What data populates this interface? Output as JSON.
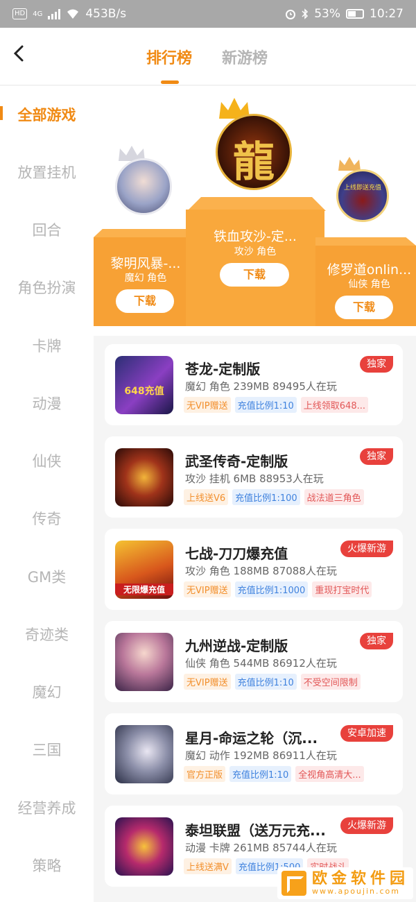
{
  "statusbar": {
    "hd": "HD",
    "net": "4G",
    "speed": "453B/s",
    "battery": "53%",
    "time": "10:27"
  },
  "header": {
    "tabs": [
      {
        "label": "排行榜",
        "active": true
      },
      {
        "label": "新游榜",
        "active": false
      }
    ]
  },
  "sidebar": {
    "categories": [
      "全部游戏",
      "放置挂机",
      "回合",
      "角色扮演",
      "卡牌",
      "动漫",
      "仙侠",
      "传奇",
      "GM类",
      "奇迹类",
      "魔幻",
      "三国",
      "经营养成",
      "策略"
    ]
  },
  "podium": {
    "first": {
      "name": "铁血攻沙-定...",
      "tags": "攻沙 角色",
      "button": "下载",
      "avatar_text": "龍"
    },
    "second": {
      "name": "黎明风暴-...",
      "tags": "魔幻 角色",
      "button": "下载"
    },
    "third": {
      "name": "修罗道onlin...",
      "tags": "仙侠 角色",
      "button": "下载",
      "avatar_text": "上线即送充值"
    }
  },
  "games": [
    {
      "name": "苍龙-定制版",
      "meta": "魔幻 角色 239MB 89495人在玩",
      "badge": "独家",
      "thumb_text": "648充值",
      "tags": [
        {
          "text": "无VIP赠送",
          "kind": "or"
        },
        {
          "text": "充值比例1:10",
          "kind": "bl"
        },
        {
          "text": "上线领取648...",
          "kind": "rd"
        }
      ]
    },
    {
      "name": "武圣传奇-定制版",
      "meta": "攻沙 挂机 6MB 88953人在玩",
      "badge": "独家",
      "thumb_text": "",
      "tags": [
        {
          "text": "上线送V6",
          "kind": "or"
        },
        {
          "text": "充值比例1:100",
          "kind": "bl"
        },
        {
          "text": "战法道三角色",
          "kind": "rd"
        }
      ]
    },
    {
      "name": "七战-刀刀爆充值",
      "meta": "攻沙 角色 188MB 87088人在玩",
      "badge": "火爆新游",
      "thumb_text": "无限爆充值",
      "tags": [
        {
          "text": "无VIP赠送",
          "kind": "or"
        },
        {
          "text": "充值比例1:1000",
          "kind": "bl"
        },
        {
          "text": "重现打宝时代",
          "kind": "rd"
        }
      ]
    },
    {
      "name": "九州逆战-定制版",
      "meta": "仙侠 角色 544MB 86912人在玩",
      "badge": "独家",
      "thumb_text": "",
      "tags": [
        {
          "text": "无VIP赠送",
          "kind": "or"
        },
        {
          "text": "充值比例1:10",
          "kind": "bl"
        },
        {
          "text": "不受空间限制",
          "kind": "rd"
        }
      ]
    },
    {
      "name": "星月-命运之轮（沉...",
      "meta": "魔幻 动作 192MB 86911人在玩",
      "badge": "安卓加速",
      "thumb_text": "",
      "tags": [
        {
          "text": "官方正版",
          "kind": "or"
        },
        {
          "text": "充值比例1:10",
          "kind": "bl"
        },
        {
          "text": "全视角高清大...",
          "kind": "rd"
        }
      ]
    },
    {
      "name": "泰坦联盟（送万元充...",
      "meta": "动漫 卡牌 261MB 85744人在玩",
      "badge": "火爆新游",
      "thumb_text": "",
      "tags": [
        {
          "text": "上线送满V",
          "kind": "or"
        },
        {
          "text": "充值比例1:500",
          "kind": "bl"
        },
        {
          "text": "实时战斗",
          "kind": "rd"
        }
      ]
    }
  ],
  "watermark": {
    "cn": "欧金软件园",
    "en": "www.apoujin.com"
  },
  "colors": {
    "accent": "#f08a14",
    "podium": "#f7a135",
    "badge": "#e8413c"
  }
}
